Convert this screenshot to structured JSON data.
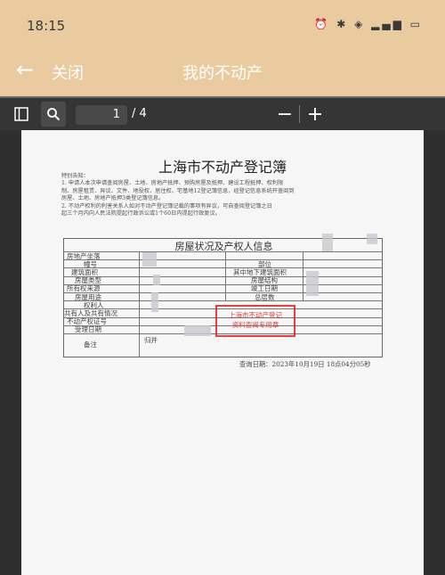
{
  "status_bar": {
    "time": "18:15",
    "icons": [
      "alarm-icon",
      "bluetooth-icon",
      "wifi-icon",
      "signal-icon",
      "battery-icon"
    ]
  },
  "app_bar": {
    "back_icon": "back-arrow-icon",
    "close_label": "关闭",
    "title": "我的不动产"
  },
  "pdf_toolbar": {
    "page_current": "1",
    "page_total": "/ 4"
  },
  "document": {
    "title": "上海市不动产登记簿",
    "notice": {
      "heading": "特别告知：",
      "line1": "1. 申请人本次申请查阅房屋、土地、房地产抵押、预购房屋及抵押、建设工程抵押、权利限",
      "line2": "制、房屋租赁、异议、文件、地役权、居住权、宅基地12登记簿信息，经登记信息系统开查阅到",
      "line3": "房屋、土地、房地产抵押3类登记簿信息。",
      "line4": "2. 不动产权利的利害关系人如对不动产登记簿记载的事项有异议，可自查阅登记簿之日",
      "line5": "起三个月内向人民法院提起行政诉讼或1个60日内提起行政复议。"
    },
    "table_title": "房屋状况及产权人信息",
    "left_labels": [
      "房地产坐落",
      "幢号",
      "建筑面积",
      "房屋类型",
      "所有权来源",
      "房屋用途",
      "权利人",
      "共有人及共有情况",
      "不动产权证号",
      "受理日期",
      "备注"
    ],
    "right_labels": [
      "部位",
      "其中地下建筑面积",
      "房屋结构",
      "竣工日期",
      "总层数"
    ],
    "remark_value": "归并",
    "stamp_text_line1": "上海市不动产登记",
    "stamp_text_line2": "资料查阅专用章",
    "query_date": "查询日期：2023年10月19日 18点04分05秒"
  }
}
